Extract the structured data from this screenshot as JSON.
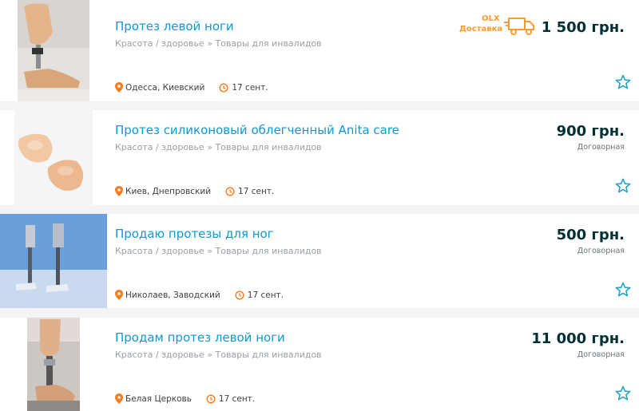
{
  "listings": [
    {
      "title": "Протез левой ноги",
      "category": "Красота / здоровье » Товары для инвалидов",
      "location": "Одесса, Киевский",
      "date": "17 сент.",
      "price": "1 500 грн.",
      "negotiable": "",
      "delivery_brand": "OLX",
      "delivery_label": "Доставка"
    },
    {
      "title": "Протез силиконовый облегченный Anita care",
      "category": "Красота / здоровье » Товары для инвалидов",
      "location": "Киев, Днепровский",
      "date": "17 сент.",
      "price": "900 грн.",
      "negotiable": "Договорная"
    },
    {
      "title": "Продаю протезы для ног",
      "category": "Красота / здоровье » Товары для инвалидов",
      "location": "Николаев, Заводский",
      "date": "17 сент.",
      "price": "500 грн.",
      "negotiable": "Договорная"
    },
    {
      "title": "Продам протез левой ноги",
      "category": "Красота / здоровье » Товары для инвалидов",
      "location": "Белая Церковь",
      "date": "17 сент.",
      "price": "11 000 грн.",
      "negotiable": "Договорная"
    }
  ],
  "colors": {
    "title": "#0b9ad5",
    "price": "#002f34",
    "accent_orange": "#ff7a1a",
    "star": "#23a6c9"
  },
  "icons": {
    "location": "location-pin-icon",
    "date": "clock-refresh-icon",
    "favorite": "star-outline-icon",
    "delivery": "delivery-truck-icon"
  }
}
